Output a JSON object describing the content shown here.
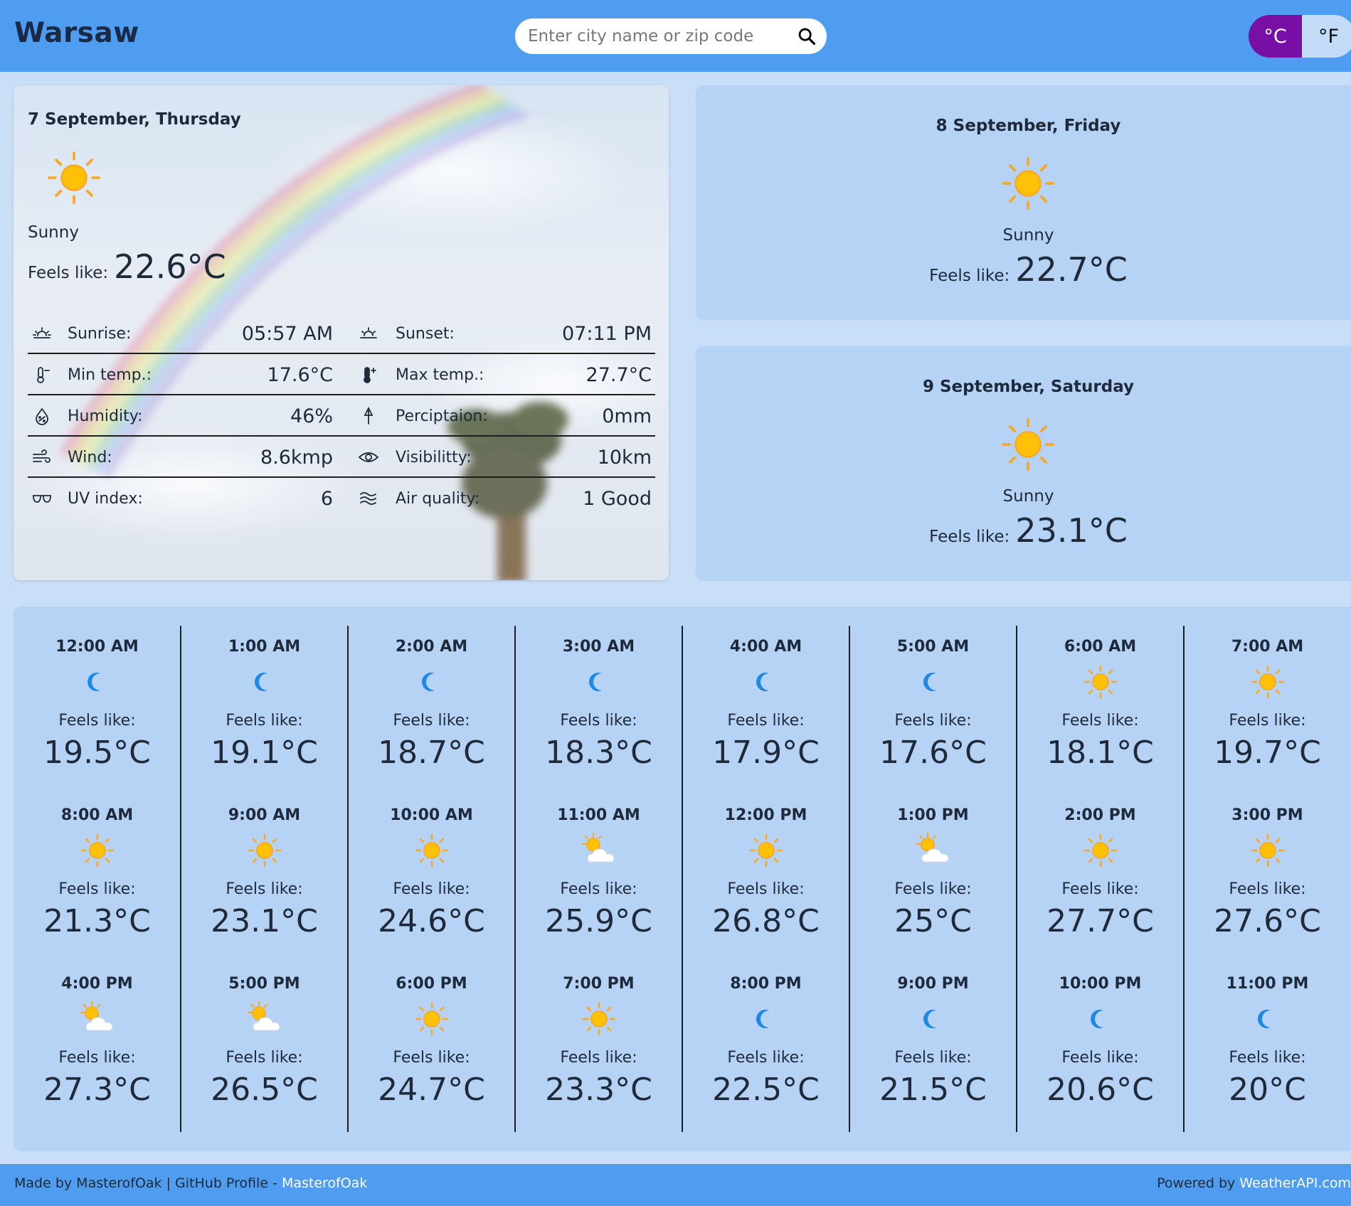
{
  "header": {
    "city": "Warsaw",
    "search_placeholder": "Enter city name or zip code",
    "unit_c": "°C",
    "unit_f": "°F",
    "active_unit": "C"
  },
  "today": {
    "date": "7 September, Thursday",
    "icon": "sun-icon",
    "condition": "Sunny",
    "feels_label": "Feels like:",
    "feels_value": "22.6°C",
    "details": [
      {
        "l_icon": "sunrise-icon",
        "l_label": "Sunrise:",
        "l_value": "05:57 AM",
        "r_icon": "sunset-icon",
        "r_label": "Sunset:",
        "r_value": "07:11 PM"
      },
      {
        "l_icon": "thermometer-minus-icon",
        "l_label": "Min temp.:",
        "l_value": "17.6°C",
        "r_icon": "thermometer-plus-icon",
        "r_label": "Max temp.:",
        "r_value": "27.7°C"
      },
      {
        "l_icon": "humidity-icon",
        "l_label": "Humidity:",
        "l_value": "46%",
        "r_icon": "umbrella-icon",
        "r_label": "Perciptaion:",
        "r_value": "0mm"
      },
      {
        "l_icon": "wind-icon",
        "l_label": "Wind:",
        "l_value": "8.6kmp",
        "r_icon": "eye-icon",
        "r_label": "Visibilitty:",
        "r_value": "10km"
      },
      {
        "l_icon": "sunglasses-icon",
        "l_label": "UV index:",
        "l_value": "6",
        "r_icon": "air-quality-icon",
        "r_label": "Air quality:",
        "r_value": "1 Good"
      }
    ]
  },
  "forecast": [
    {
      "date": "8 September, Friday",
      "icon": "sun-icon",
      "condition": "Sunny",
      "feels_label": "Feels like:",
      "feels_value": "22.7°C"
    },
    {
      "date": "9 September, Saturday",
      "icon": "sun-icon",
      "condition": "Sunny",
      "feels_label": "Feels like:",
      "feels_value": "23.1°C"
    }
  ],
  "hourly": {
    "feels_label": "Feels like:",
    "hours": [
      {
        "time": "12:00 AM",
        "icon": "moon",
        "temp": "19.5°C"
      },
      {
        "time": "1:00 AM",
        "icon": "moon",
        "temp": "19.1°C"
      },
      {
        "time": "2:00 AM",
        "icon": "moon",
        "temp": "18.7°C"
      },
      {
        "time": "3:00 AM",
        "icon": "moon",
        "temp": "18.3°C"
      },
      {
        "time": "4:00 AM",
        "icon": "moon",
        "temp": "17.9°C"
      },
      {
        "time": "5:00 AM",
        "icon": "moon",
        "temp": "17.6°C"
      },
      {
        "time": "6:00 AM",
        "icon": "sun",
        "temp": "18.1°C"
      },
      {
        "time": "7:00 AM",
        "icon": "sun",
        "temp": "19.7°C"
      },
      {
        "time": "8:00 AM",
        "icon": "sun",
        "temp": "21.3°C"
      },
      {
        "time": "9:00 AM",
        "icon": "sun",
        "temp": "23.1°C"
      },
      {
        "time": "10:00 AM",
        "icon": "sun",
        "temp": "24.6°C"
      },
      {
        "time": "11:00 AM",
        "icon": "partly-cloudy",
        "temp": "25.9°C"
      },
      {
        "time": "12:00 PM",
        "icon": "sun",
        "temp": "26.8°C"
      },
      {
        "time": "1:00 PM",
        "icon": "partly-cloudy",
        "temp": "25°C"
      },
      {
        "time": "2:00 PM",
        "icon": "sun",
        "temp": "27.7°C"
      },
      {
        "time": "3:00 PM",
        "icon": "sun",
        "temp": "27.6°C"
      },
      {
        "time": "4:00 PM",
        "icon": "partly-cloudy",
        "temp": "27.3°C"
      },
      {
        "time": "5:00 PM",
        "icon": "partly-cloudy",
        "temp": "26.5°C"
      },
      {
        "time": "6:00 PM",
        "icon": "sun",
        "temp": "24.7°C"
      },
      {
        "time": "7:00 PM",
        "icon": "sun",
        "temp": "23.3°C"
      },
      {
        "time": "8:00 PM",
        "icon": "moon",
        "temp": "22.5°C"
      },
      {
        "time": "9:00 PM",
        "icon": "moon",
        "temp": "21.5°C"
      },
      {
        "time": "10:00 PM",
        "icon": "moon",
        "temp": "20.6°C"
      },
      {
        "time": "11:00 PM",
        "icon": "moon",
        "temp": "20°C"
      }
    ]
  },
  "footer": {
    "made_by": "Made by MasterofOak | GitHub Profile - ",
    "github_link": "MasterofOak",
    "powered_by": "Powered by ",
    "api_link": "WeatherAPI.com"
  },
  "colors": {
    "header_bg": "#4f9df0",
    "page_bg": "#c9dff7",
    "card_bg": "#b6d3f6",
    "accent_active_unit": "#7a0fa8",
    "sun_yellow": "#ffc107",
    "moon_blue": "#1976d2"
  }
}
